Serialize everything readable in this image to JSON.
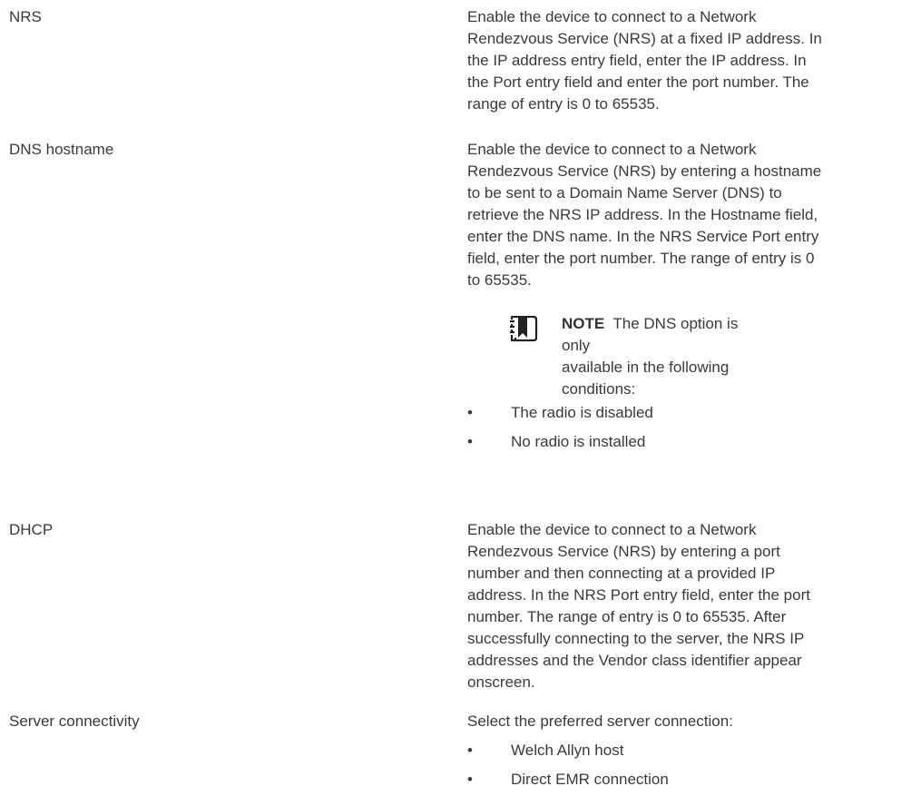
{
  "rows": [
    {
      "term": "NRS",
      "description": [
        "Enable the device to connect to a Network",
        "Rendezvous Service (NRS) at a fixed IP address. In",
        "the IP address entry field, enter the IP address. In",
        "the Port entry field and enter the port number. The",
        "range of entry is 0 to 65535."
      ]
    },
    {
      "term": "DNS hostname",
      "description": [
        "Enable the device to connect to a Network",
        "Rendezvous Service (NRS) by entering a hostname",
        "to be sent to a Domain Name Server (DNS) to",
        "retrieve the NRS IP address. In the Hostname field,",
        "enter the DNS name. In the NRS Service Port entry",
        "field, enter the port number. The range of entry is 0",
        "to 65535."
      ],
      "note": {
        "label": "NOTE",
        "lines": [
          "The DNS option is only",
          "available in the following",
          "conditions:"
        ]
      },
      "bullets": [
        "The radio is disabled",
        "No radio is installed"
      ]
    },
    {
      "term": "DHCP",
      "description": [
        "Enable the device to connect to a Network",
        "Rendezvous Service (NRS) by entering a port",
        "number and then connecting at a provided IP",
        "address. In the NRS Port entry field, enter the port",
        "number. The range of entry is 0 to 65535. After",
        "successfully connecting to the server, the NRS IP",
        "addresses and the Vendor class identifier appear",
        "onscreen."
      ]
    },
    {
      "term": "Server connectivity",
      "description": [
        "Select the preferred server connection:"
      ],
      "bullets": [
        "Welch Allyn host",
        "Direct EMR connection"
      ]
    }
  ],
  "bullet_glyph": "•",
  "icons": {
    "note": "note-book-icon"
  },
  "colors": {
    "text": "#3a3a3a",
    "icon": "#222222"
  }
}
